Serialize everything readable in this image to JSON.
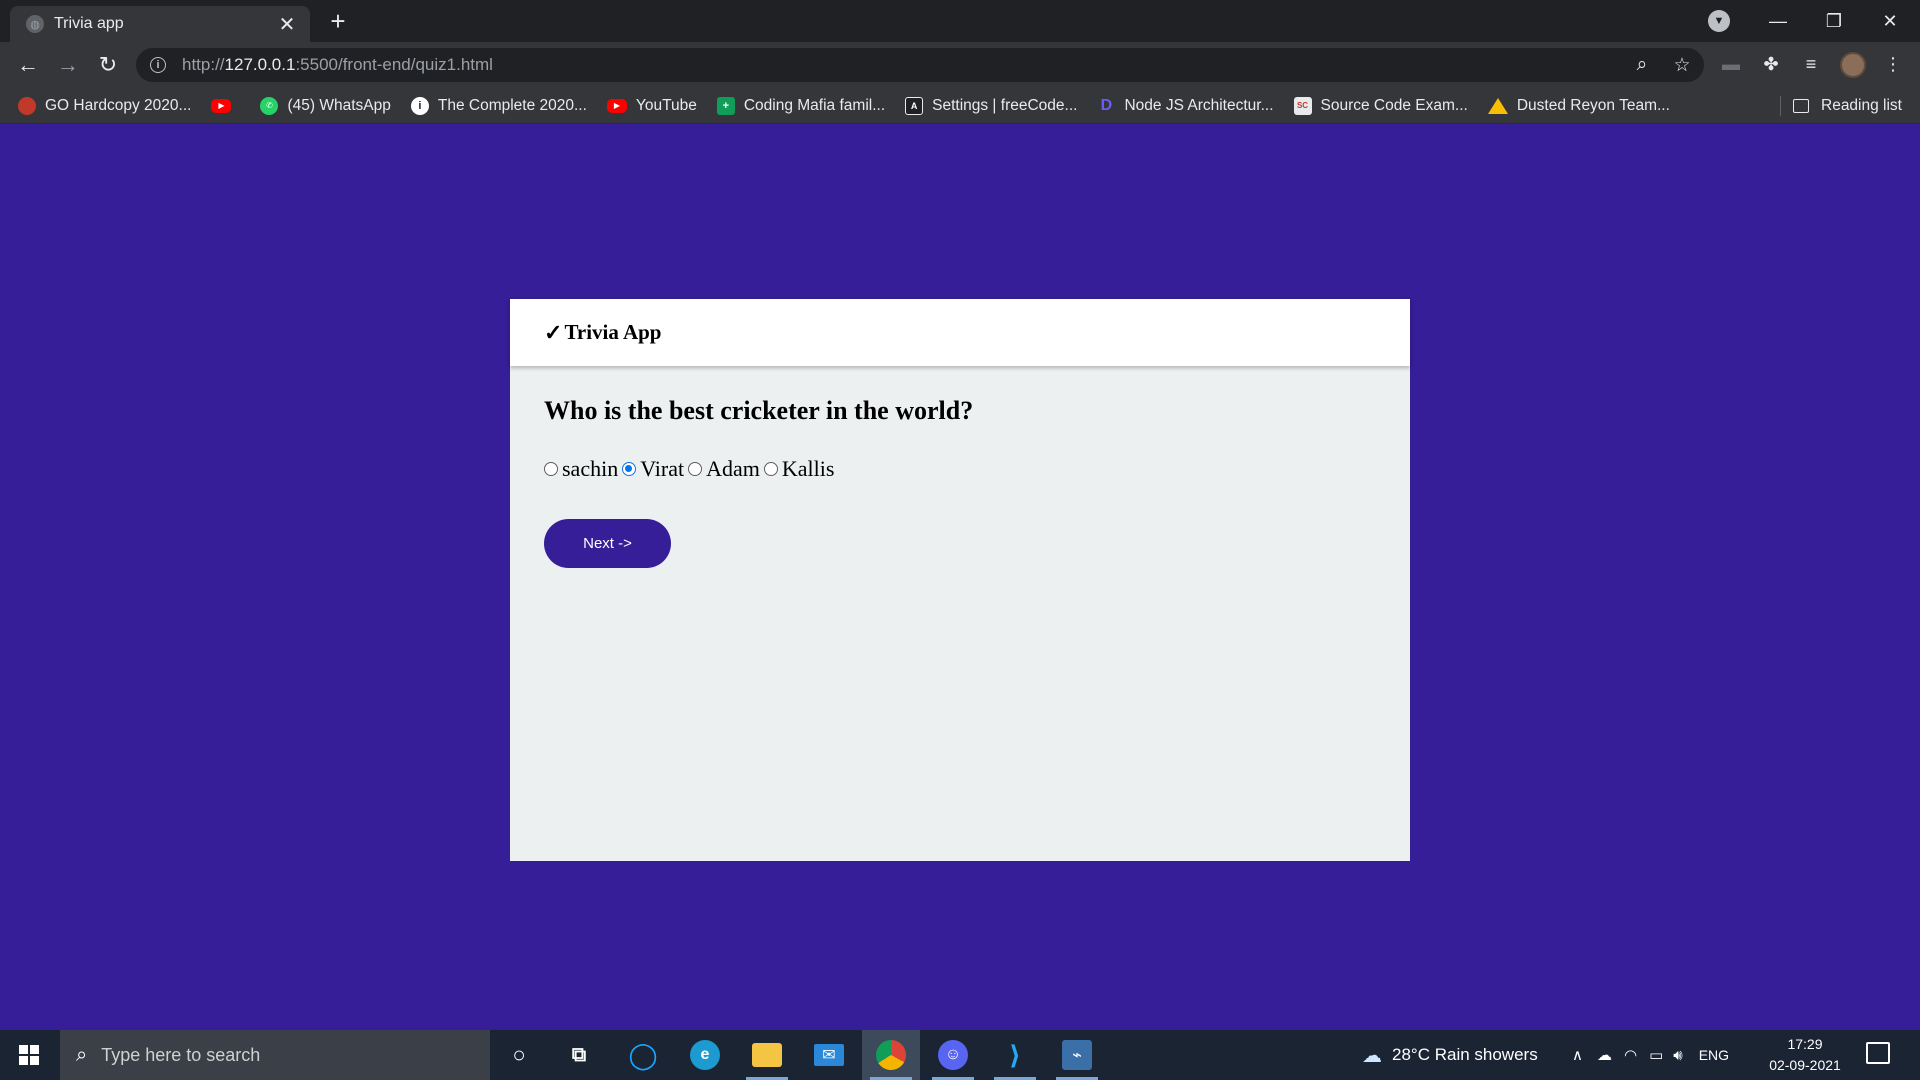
{
  "browser": {
    "tab_title": "Trivia app",
    "tab_close": "✕",
    "new_tab": "+",
    "url_prefix": "http://",
    "url_host": "127.0.0.1",
    "url_rest": ":5500/front-end/quiz1.html",
    "bookmarks": [
      {
        "label": "GO Hardcopy 2020...",
        "icon": "go-icon"
      },
      {
        "label": "",
        "icon": "youtube-icon"
      },
      {
        "label": "(45) WhatsApp",
        "icon": "whatsapp-icon"
      },
      {
        "label": "The Complete 2020...",
        "icon": "info-circle-icon"
      },
      {
        "label": "YouTube",
        "icon": "youtube-icon"
      },
      {
        "label": "Coding Mafia famil...",
        "icon": "sheets-icon"
      },
      {
        "label": "Settings | freeCode...",
        "icon": "freecodecamp-icon"
      },
      {
        "label": "Node JS Architectur...",
        "icon": "node-icon"
      },
      {
        "label": "Source Code Exam...",
        "icon": "source-code-icon"
      },
      {
        "label": "Dusted Reyon Team...",
        "icon": "drive-icon"
      }
    ],
    "reading_list": "Reading list"
  },
  "app": {
    "header_check": "✓",
    "header_title": "Trivia App",
    "question": "Who is the best cricketer in the world?",
    "options": [
      "sachin",
      "Virat",
      "Adam",
      "Kallis"
    ],
    "selected_option": "Virat",
    "next_label": "Next ->"
  },
  "taskbar": {
    "search_placeholder": "Type here to search",
    "weather": "28°C  Rain showers",
    "language": "ENG",
    "time": "17:29",
    "date": "02-09-2021"
  },
  "colors": {
    "page_background": "#351e97",
    "card_background": "#ecf0f1",
    "button_background": "#351e97",
    "radio_accent": "#0b74e5"
  }
}
